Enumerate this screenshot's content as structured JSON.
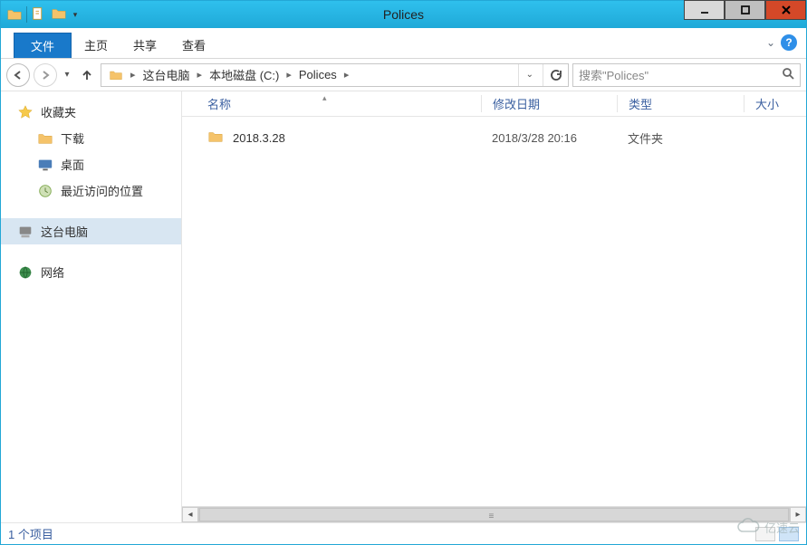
{
  "window": {
    "title": "Polices"
  },
  "ribbon": {
    "file": "文件",
    "tabs": [
      "主页",
      "共享",
      "查看"
    ]
  },
  "breadcrumb": {
    "items": [
      "这台电脑",
      "本地磁盘 (C:)",
      "Polices"
    ]
  },
  "search": {
    "placeholder": "搜索\"Polices\""
  },
  "tree": {
    "favorites": "收藏夹",
    "downloads": "下载",
    "desktop": "桌面",
    "recent": "最近访问的位置",
    "thispc": "这台电脑",
    "network": "网络"
  },
  "columns": {
    "name": "名称",
    "date": "修改日期",
    "type": "类型",
    "size": "大小"
  },
  "items": [
    {
      "name": "2018.3.28",
      "date": "2018/3/28 20:16",
      "type": "文件夹"
    }
  ],
  "status": {
    "count": "1 个项目"
  },
  "watermark": "亿速云"
}
